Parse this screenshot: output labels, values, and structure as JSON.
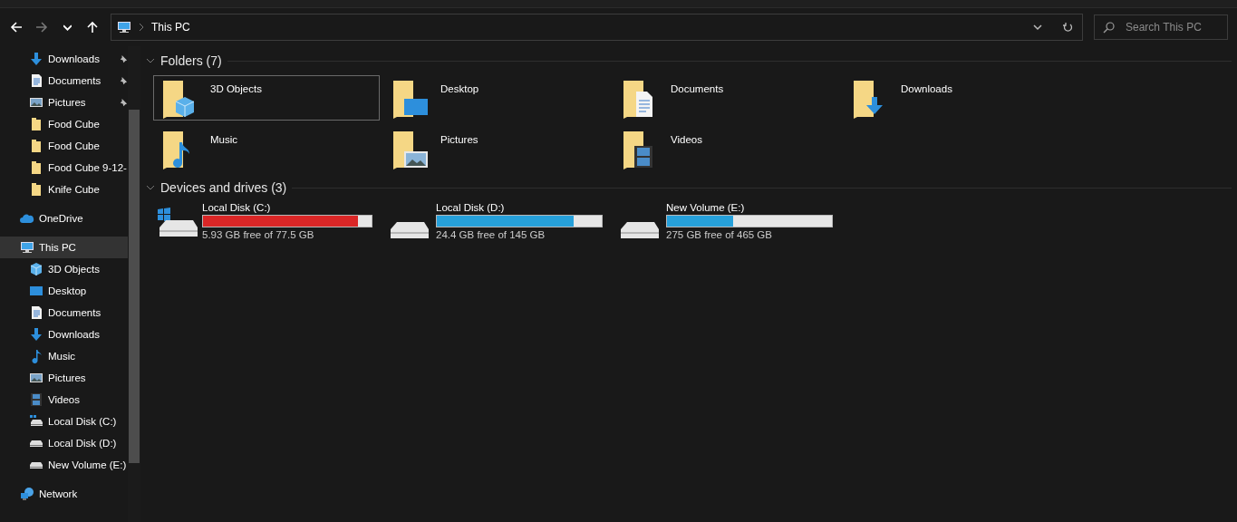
{
  "address_bar": {
    "path": [
      "This PC"
    ]
  },
  "search": {
    "placeholder": "Search This PC"
  },
  "sidebar": {
    "quick_access": [
      {
        "label": "Downloads",
        "kind": "downloads",
        "pinned": true
      },
      {
        "label": "Documents",
        "kind": "documents",
        "pinned": true
      },
      {
        "label": "Pictures",
        "kind": "pictures",
        "pinned": true
      },
      {
        "label": "Food Cube",
        "kind": "folder",
        "pinned": false
      },
      {
        "label": "Food Cube",
        "kind": "folder",
        "pinned": false
      },
      {
        "label": "Food Cube 9-12-",
        "kind": "folder",
        "pinned": false
      },
      {
        "label": "Knife Cube",
        "kind": "folder",
        "pinned": false
      }
    ],
    "roots": [
      {
        "label": "OneDrive",
        "kind": "cloud",
        "selected": false
      },
      {
        "label": "This PC",
        "kind": "pc",
        "selected": true,
        "children": [
          {
            "label": "3D Objects",
            "kind": "objects"
          },
          {
            "label": "Desktop",
            "kind": "desktop"
          },
          {
            "label": "Documents",
            "kind": "documents"
          },
          {
            "label": "Downloads",
            "kind": "downloads"
          },
          {
            "label": "Music",
            "kind": "music"
          },
          {
            "label": "Pictures",
            "kind": "pictures"
          },
          {
            "label": "Videos",
            "kind": "videos"
          },
          {
            "label": "Local Disk (C:)",
            "kind": "system-drive"
          },
          {
            "label": "Local Disk (D:)",
            "kind": "drive"
          },
          {
            "label": "New Volume (E:)",
            "kind": "drive"
          }
        ]
      },
      {
        "label": "Network",
        "kind": "network",
        "selected": false
      }
    ]
  },
  "sections": [
    {
      "title": "Folders (7)",
      "kind": "folders",
      "items": [
        {
          "label": "3D Objects",
          "kind": "objects",
          "selected": true
        },
        {
          "label": "Desktop",
          "kind": "desktop",
          "selected": false
        },
        {
          "label": "Documents",
          "kind": "documents",
          "selected": false
        },
        {
          "label": "Downloads",
          "kind": "downloads",
          "selected": false
        },
        {
          "label": "Music",
          "kind": "music",
          "selected": false
        },
        {
          "label": "Pictures",
          "kind": "pictures",
          "selected": false
        },
        {
          "label": "Videos",
          "kind": "videos",
          "selected": false
        }
      ]
    },
    {
      "title": "Devices and drives (3)",
      "kind": "drives",
      "items": [
        {
          "label": "Local Disk (C:)",
          "kind": "system-drive",
          "level": 0.92,
          "warning": true,
          "free": "5.93 GB free of 77.5 GB"
        },
        {
          "label": "Local Disk (D:)",
          "kind": "drive",
          "level": 0.83,
          "warning": false,
          "free": "24.4 GB free of 145 GB"
        },
        {
          "label": "New Volume (E:)",
          "kind": "drive",
          "level": 0.4,
          "warning": false,
          "free": "275 GB free of 465 GB"
        }
      ]
    }
  ]
}
